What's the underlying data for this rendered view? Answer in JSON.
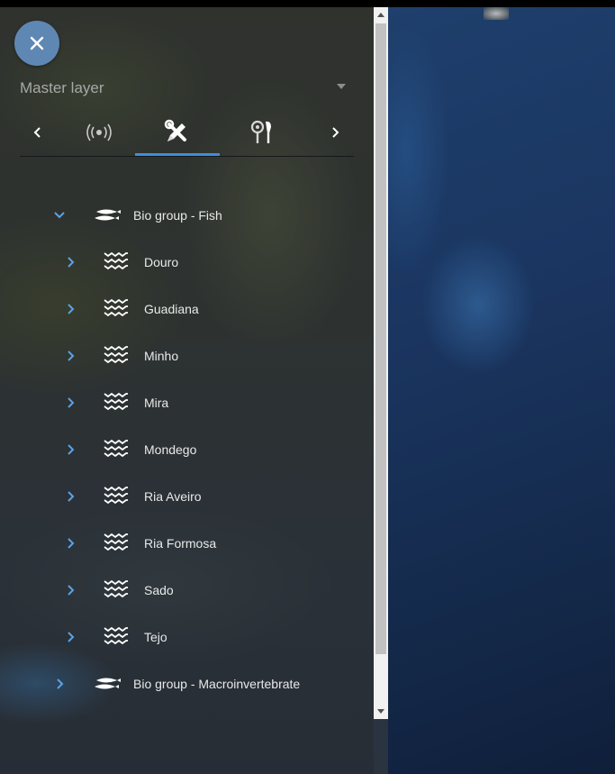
{
  "panel": {
    "close_label": "×",
    "master_layer": {
      "label": "Master layer"
    },
    "tabs": [
      {
        "icon": "signal-broadcast-icon"
      },
      {
        "icon": "tools-pencil-wrench-icon"
      },
      {
        "icon": "probe-sensor-icon"
      }
    ],
    "active_tab": 1
  },
  "tree": {
    "groups": [
      {
        "label": "Bio group - Fish",
        "expanded": true,
        "children": [
          "Douro",
          "Guadiana",
          "Minho",
          "Mira",
          "Mondego",
          "Ria Aveiro",
          "Ria Formosa",
          "Sado",
          "Tejo"
        ]
      },
      {
        "label": "Bio group - Macroinvertebrate",
        "expanded": false,
        "children": []
      }
    ]
  },
  "colors": {
    "accent": "#3d8fd8",
    "chevron": "#5aa3e6",
    "close_button": "#5f87b4",
    "text": "#e9e9e9"
  }
}
